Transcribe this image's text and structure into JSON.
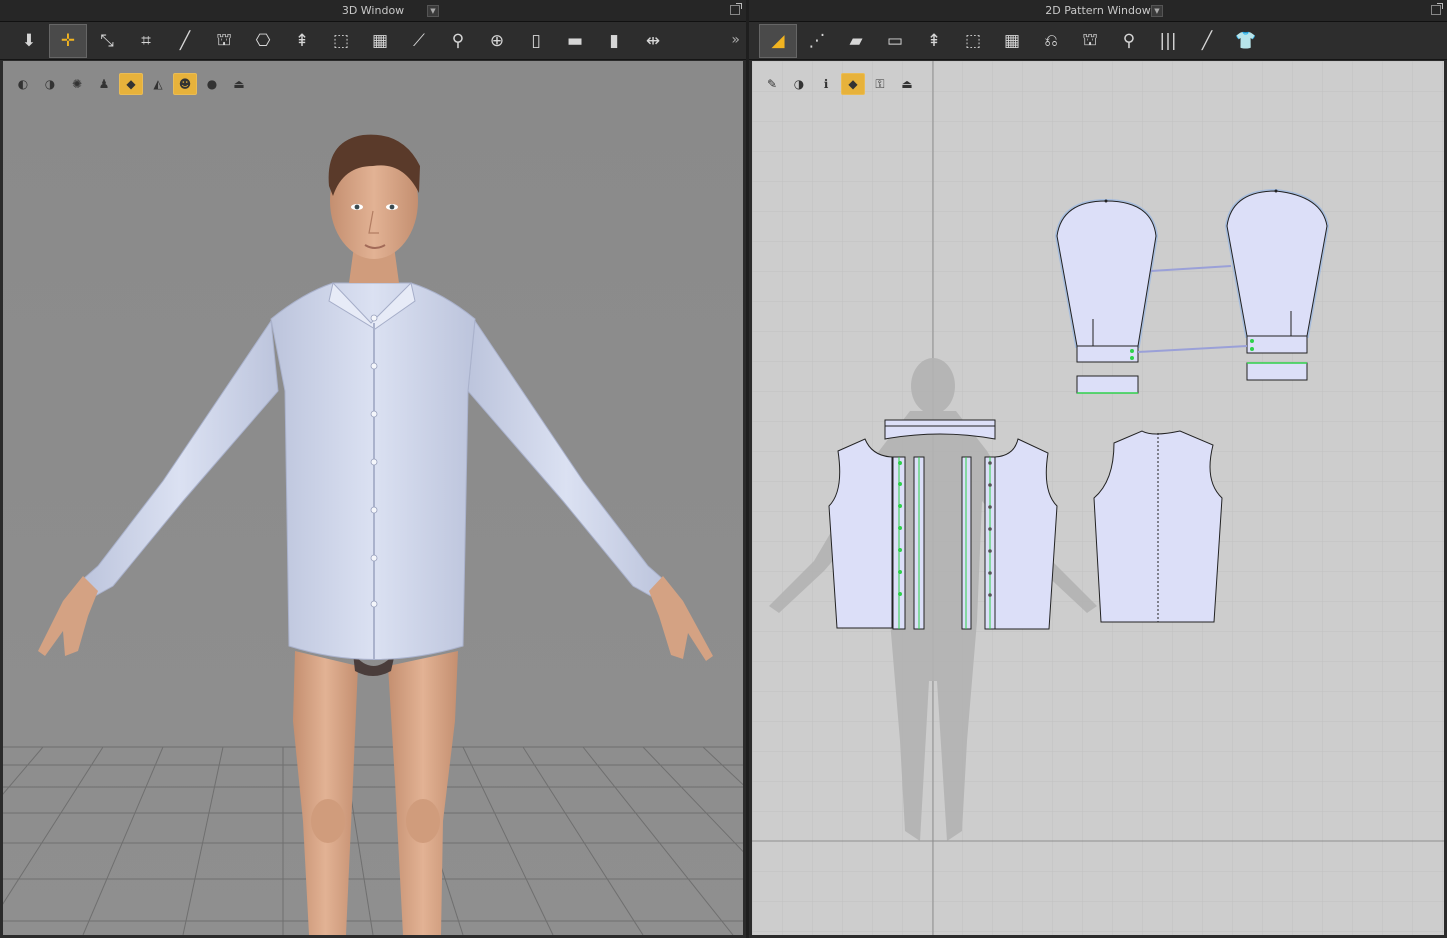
{
  "windows": {
    "left_title": "3D Window",
    "right_title": "2D Pattern Window"
  },
  "toolbar3d": {
    "tools": [
      {
        "name": "simulation-icon",
        "glyph": "⬇"
      },
      {
        "name": "select-move-icon",
        "glyph": "✛",
        "selected": true
      },
      {
        "name": "select-mesh-icon",
        "glyph": "⤡"
      },
      {
        "name": "fold-arrangement-icon",
        "glyph": "⌗"
      },
      {
        "name": "segment-sewing-icon",
        "glyph": "╱"
      },
      {
        "name": "arrange-icon",
        "glyph": "⛫"
      },
      {
        "name": "puckering-icon",
        "glyph": "⎔"
      },
      {
        "name": "pin-icon",
        "glyph": "⇞"
      },
      {
        "name": "tack-icon",
        "glyph": "⬚"
      },
      {
        "name": "strengthen-icon",
        "glyph": "▦"
      },
      {
        "name": "measure-icon",
        "glyph": "⟋"
      },
      {
        "name": "zipper-icon",
        "glyph": "⚲"
      },
      {
        "name": "button-icon",
        "glyph": "⊕"
      },
      {
        "name": "buttonhole-icon",
        "glyph": "▯"
      },
      {
        "name": "topstitch-icon",
        "glyph": "▬"
      },
      {
        "name": "graphic-icon",
        "glyph": "▮"
      },
      {
        "name": "transform-icon",
        "glyph": "⇹"
      }
    ],
    "more": "»"
  },
  "toolbar2d": {
    "tools": [
      {
        "name": "transform-pattern-icon",
        "glyph": "◢",
        "selected": true
      },
      {
        "name": "edit-point-icon",
        "glyph": "⋰"
      },
      {
        "name": "polygon-icon",
        "glyph": "▰"
      },
      {
        "name": "rectangle-icon",
        "glyph": "▭"
      },
      {
        "name": "internal-line-icon",
        "glyph": "⇞"
      },
      {
        "name": "dart-icon",
        "glyph": "⬚"
      },
      {
        "name": "texture-icon",
        "glyph": "▦"
      },
      {
        "name": "fold-icon",
        "glyph": "⎌"
      },
      {
        "name": "shirt-transform-icon",
        "glyph": "⛫"
      },
      {
        "name": "trace-icon",
        "glyph": "⚲"
      },
      {
        "name": "pleat-icon",
        "glyph": "|||"
      },
      {
        "name": "segment-line-icon",
        "glyph": "╱"
      },
      {
        "name": "garment-icon",
        "glyph": "👕"
      }
    ]
  },
  "minibar3d": [
    {
      "name": "avatar-display-icon",
      "glyph": "◐"
    },
    {
      "name": "garment-display-icon",
      "glyph": "◑"
    },
    {
      "name": "texture-display-icon",
      "glyph": "✺"
    },
    {
      "name": "avatar-pose-icon",
      "glyph": "♟"
    },
    {
      "name": "surface-display-icon",
      "glyph": "◆",
      "highlighted": true
    },
    {
      "name": "thickness-display-icon",
      "glyph": "◭"
    },
    {
      "name": "skin-display-icon",
      "glyph": "☻",
      "highlighted": true
    },
    {
      "name": "shading-display-icon",
      "glyph": "●"
    },
    {
      "name": "arrangement-display-icon",
      "glyph": "⏏"
    }
  ],
  "minibar2d": [
    {
      "name": "pattern-line-icon",
      "glyph": "✎"
    },
    {
      "name": "pattern-display-icon",
      "glyph": "◑"
    },
    {
      "name": "info-icon",
      "glyph": "ℹ"
    },
    {
      "name": "fill-display-icon",
      "glyph": "◆",
      "highlighted": true
    },
    {
      "name": "lock-display-icon",
      "glyph": "⚿"
    },
    {
      "name": "avatar-silhouette-icon",
      "glyph": "⏏"
    }
  ],
  "colors": {
    "pattern_fill": "#dcdff8",
    "selected_outline": "#8fb4e8",
    "seam_green": "#2ed14a",
    "shirt": "#cfd6ec",
    "skin": "#d9a888",
    "viewport3d_bg": "#8c8c8c",
    "viewport2d_bg": "#cdcdcd",
    "accent": "#f2b420"
  }
}
